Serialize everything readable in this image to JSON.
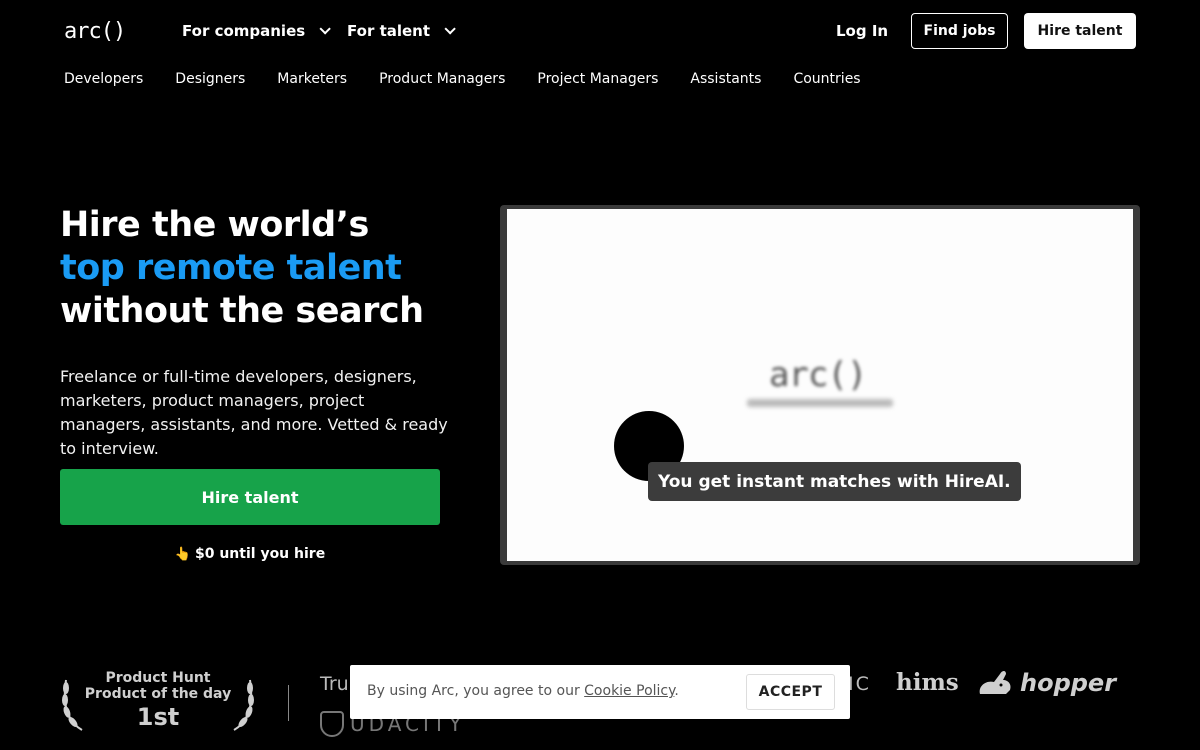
{
  "header": {
    "logo": "arc()",
    "menus": [
      {
        "label": "For companies"
      },
      {
        "label": "For talent"
      }
    ],
    "login": "Log In",
    "find_jobs": "Find jobs",
    "hire_talent": "Hire talent"
  },
  "subnav": [
    "Developers",
    "Designers",
    "Marketers",
    "Product Managers",
    "Project Managers",
    "Assistants",
    "Countries"
  ],
  "hero": {
    "title_line1": "Hire the world’s",
    "title_line2": "top remote talent",
    "title_line3": "without the search",
    "description": "Freelance or full-time developers, designers, marketers, product managers, project managers, assistants, and more. Vetted & ready to interview.",
    "cta": "Hire talent",
    "note_icon": "👆",
    "note": "$0 until you hire"
  },
  "video": {
    "logo": "arc()",
    "caption": "You get instant matches with HireAI."
  },
  "trust": {
    "badge_line1": "Product Hunt",
    "badge_line2": "Product of the day",
    "badge_rank": "1st",
    "trusted_prefix": "Tru",
    "udacity": "UDACITY",
    "partial_logo": "IC",
    "hims": "hims",
    "hopper": "hopper"
  },
  "cookie": {
    "text": "By using Arc, you agree to our ",
    "link": "Cookie Policy",
    "suffix": ".",
    "accept": "ACCEPT"
  },
  "colors": {
    "accent_blue": "#1a9bf4",
    "cta_green": "#17a34a",
    "background": "#000000"
  }
}
